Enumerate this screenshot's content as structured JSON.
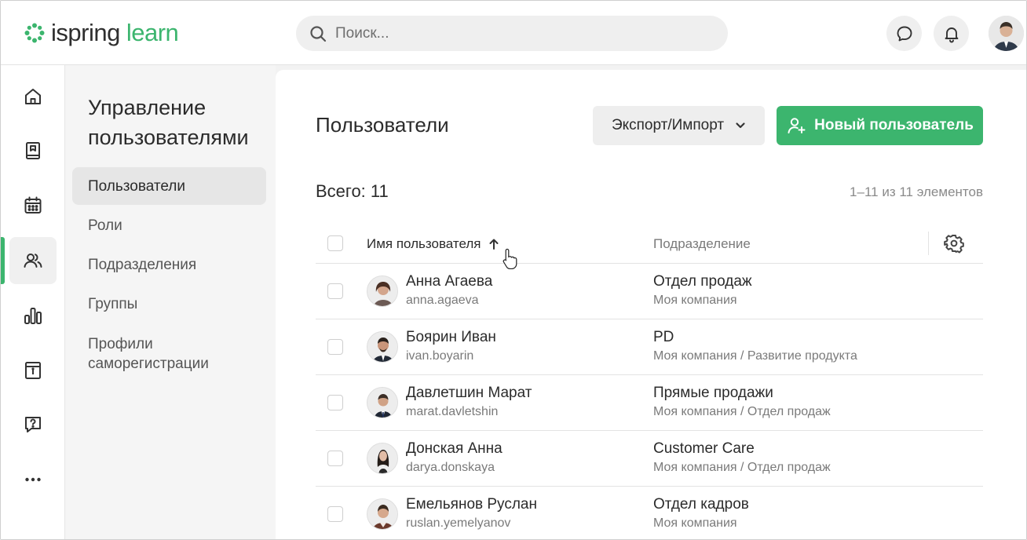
{
  "brand": {
    "name": "ispring",
    "product": "learn",
    "accent": "#3cb56e"
  },
  "search": {
    "placeholder": "Поиск..."
  },
  "sidebar": {
    "title": "Управление пользователями",
    "items": [
      {
        "label": "Пользователи",
        "active": true
      },
      {
        "label": "Роли"
      },
      {
        "label": "Подразделения"
      },
      {
        "label": "Группы"
      },
      {
        "label": "Профили саморегистрации"
      }
    ]
  },
  "rail": {
    "items": [
      {
        "icon": "home-icon"
      },
      {
        "icon": "book-icon"
      },
      {
        "icon": "calendar-icon"
      },
      {
        "icon": "users-icon",
        "active": true
      },
      {
        "icon": "reports-icon"
      },
      {
        "icon": "info-board-icon"
      },
      {
        "icon": "help-chat-icon"
      },
      {
        "icon": "more-icon"
      }
    ]
  },
  "main": {
    "title": "Пользователи",
    "export_label": "Экспорт/Импорт",
    "new_user_label": "Новый пользователь",
    "total_label": "Всего: 11",
    "range_label": "1–11 из 11 элементов",
    "columns": {
      "name": "Имя пользователя",
      "department": "Подразделение"
    },
    "users": [
      {
        "name": "Анна Агаева",
        "login": "anna.agaeva",
        "department": "Отдел продаж",
        "path": "Моя компания"
      },
      {
        "name": "Боярин Иван",
        "login": "ivan.boyarin",
        "department": "PD",
        "path": "Моя компания / Развитие продукта"
      },
      {
        "name": "Давлетшин Марат",
        "login": "marat.davletshin",
        "department": "Прямые продажи",
        "path": "Моя компания / Отдел продаж"
      },
      {
        "name": "Донская Анна",
        "login": "darya.donskaya",
        "department": "Customer Care",
        "path": "Моя компания / Отдел продаж"
      },
      {
        "name": "Емельянов Руслан",
        "login": "ruslan.yemelyanov",
        "department": "Отдел кадров",
        "path": "Моя компания"
      }
    ]
  }
}
